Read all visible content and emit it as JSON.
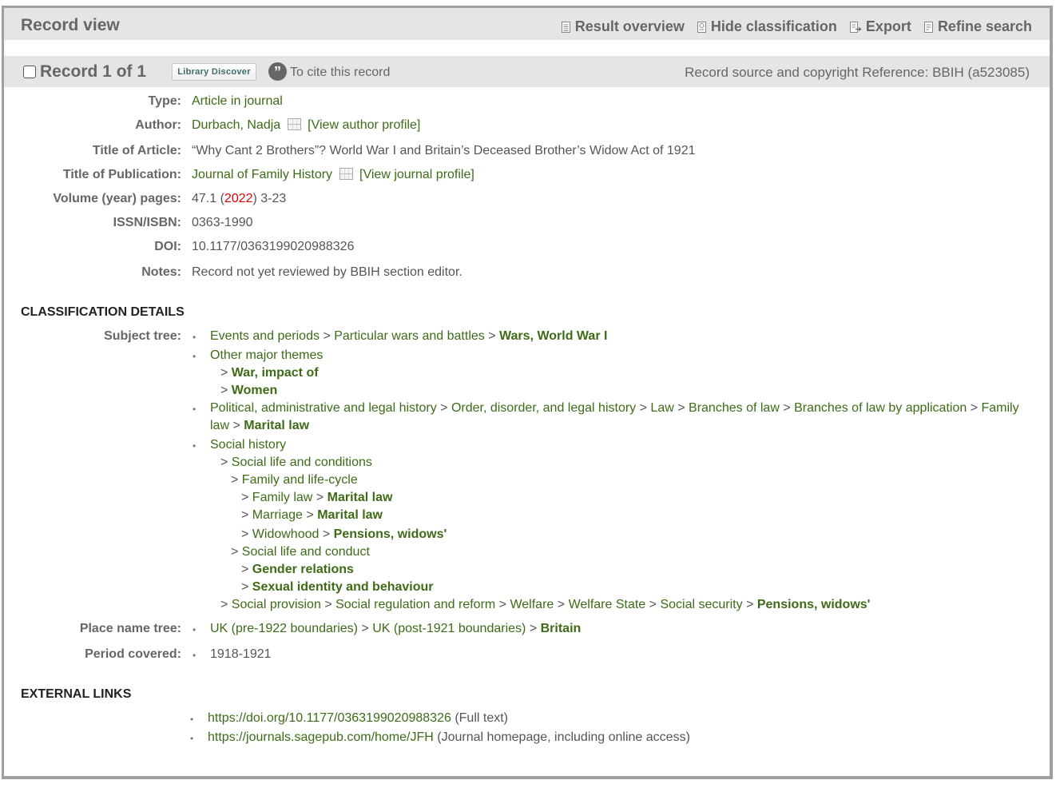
{
  "header": {
    "title": "Record view",
    "tools": [
      {
        "label": "Result overview",
        "icon": "document-icon"
      },
      {
        "label": "Hide classification",
        "icon": "classification-icon"
      },
      {
        "label": "Export",
        "icon": "export-icon"
      },
      {
        "label": "Refine search",
        "icon": "refine-icon"
      }
    ]
  },
  "record_bar": {
    "title": "Record 1 of 1",
    "library_button": "Library Discover",
    "cite_icon_glyph": "”",
    "cite_label": "To cite this record",
    "source": "Record source and copyright Reference: BBIH (a523085)"
  },
  "fields": {
    "type_label": "Type:",
    "type_value": "Article in journal",
    "author_label": "Author:",
    "author_value": "Durbach, Nadja",
    "author_profile": "[View author profile]",
    "article_label": "Title of Article:",
    "article_value": "“Why Cant 2 Brothers”? World War I and Britain’s Deceased Brother’s Widow Act of 1921",
    "publication_label": "Title of Publication:",
    "publication_value": "Journal of Family History",
    "journal_profile": "[View journal profile]",
    "volume_label": "Volume (year) pages:",
    "volume_prefix": "47.1 (",
    "volume_year": "2022",
    "volume_suffix": ") 3-23",
    "issn_label": "ISSN/ISBN:",
    "issn_value": "0363-1990",
    "doi_label": "DOI:",
    "doi_value": "10.1177/0363199020988326",
    "notes_label": "Notes:",
    "notes_value": "Record not yet reviewed by BBIH section editor."
  },
  "classification": {
    "heading": "CLASSIFICATION DETAILS",
    "subject_label": "Subject tree:",
    "place_label": "Place name tree:",
    "period_label": "Period covered:",
    "subject": {
      "l1": [
        "Events and periods",
        "Particular wars and battles",
        "Wars, World War I"
      ],
      "l2": "Other major themes",
      "l2a": "War, impact of",
      "l2b": "Women",
      "l3a": [
        "Political, administrative and legal history",
        "Order, disorder, and legal history",
        "Law",
        "Branches of law",
        "Branches of law by application",
        "Family"
      ],
      "l3b": [
        "law",
        "Marital law"
      ],
      "l4": "Social history",
      "l4a": "Social life and conditions",
      "l4b": "Family and life-cycle",
      "l4c": [
        "Family law",
        "Marital law"
      ],
      "l4d": [
        "Marriage",
        "Marital law"
      ],
      "l4e": [
        "Widowhood",
        "Pensions, widows'"
      ],
      "l4f": "Social life and conduct",
      "l4g": "Gender relations",
      "l4h": "Sexual identity and behaviour",
      "l4i": [
        "Social provision",
        "Social regulation and reform",
        "Welfare",
        "Welfare State",
        "Social security",
        "Pensions, widows'"
      ]
    },
    "place": [
      "UK (pre-1922 boundaries)",
      "UK (post-1921 boundaries)",
      "Britain"
    ],
    "period": "1918-1921",
    "bullet": "•",
    "sep": ">"
  },
  "external": {
    "heading": "EXTERNAL LINKS",
    "links": [
      {
        "url": "https://doi.org/10.1177/0363199020988326",
        "note": "(Full text)"
      },
      {
        "url": "https://journals.sagepub.com/home/JFH",
        "note": "(Journal homepage, including online access)"
      }
    ]
  }
}
